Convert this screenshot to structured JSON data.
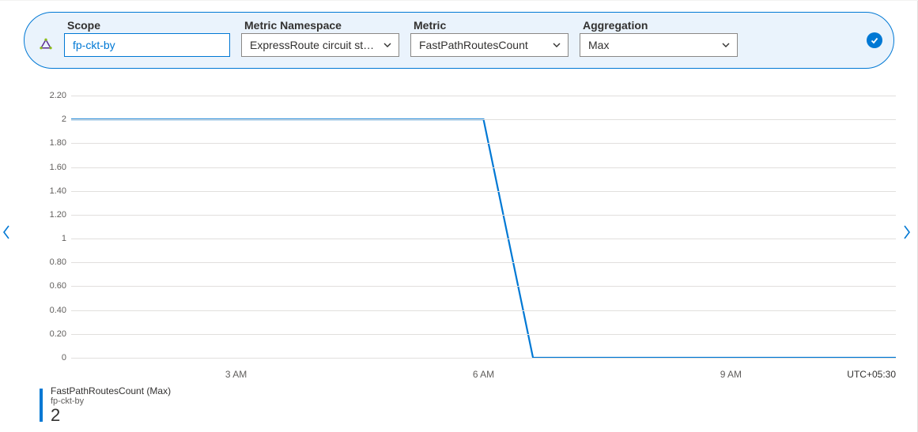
{
  "filters": {
    "scope": {
      "label": "Scope",
      "value": "fp-ckt-by"
    },
    "namespace": {
      "label": "Metric Namespace",
      "value": "ExpressRoute circuit sta…"
    },
    "metric": {
      "label": "Metric",
      "value": "FastPathRoutesCount"
    },
    "aggregation": {
      "label": "Aggregation",
      "value": "Max"
    }
  },
  "legend": {
    "title": "FastPathRoutesCount (Max)",
    "subtitle": "fp-ckt-by",
    "value": "2"
  },
  "timezone": "UTC+05:30",
  "chart_data": {
    "type": "line",
    "title": "",
    "xlabel": "",
    "ylabel": "",
    "ylim": [
      0,
      2.2
    ],
    "y_ticks": [
      0,
      0.2,
      0.4,
      0.6,
      0.8,
      1,
      1.2,
      1.4,
      1.6,
      1.8,
      2,
      2.2
    ],
    "y_tick_labels": [
      "0",
      "0.20",
      "0.40",
      "0.60",
      "0.80",
      "1",
      "1.20",
      "1.40",
      "1.60",
      "1.80",
      "2",
      "2.20"
    ],
    "x_ticks": [
      "3 AM",
      "6 AM",
      "9 AM"
    ],
    "x_domain_hours": [
      1,
      11
    ],
    "series": [
      {
        "name": "FastPathRoutesCount (Max)",
        "color": "#0078d4",
        "points": [
          {
            "x_hour": 1.0,
            "y": 2
          },
          {
            "x_hour": 6.0,
            "y": 2
          },
          {
            "x_hour": 6.6,
            "y": 0
          },
          {
            "x_hour": 11.0,
            "y": 0
          }
        ]
      }
    ]
  }
}
